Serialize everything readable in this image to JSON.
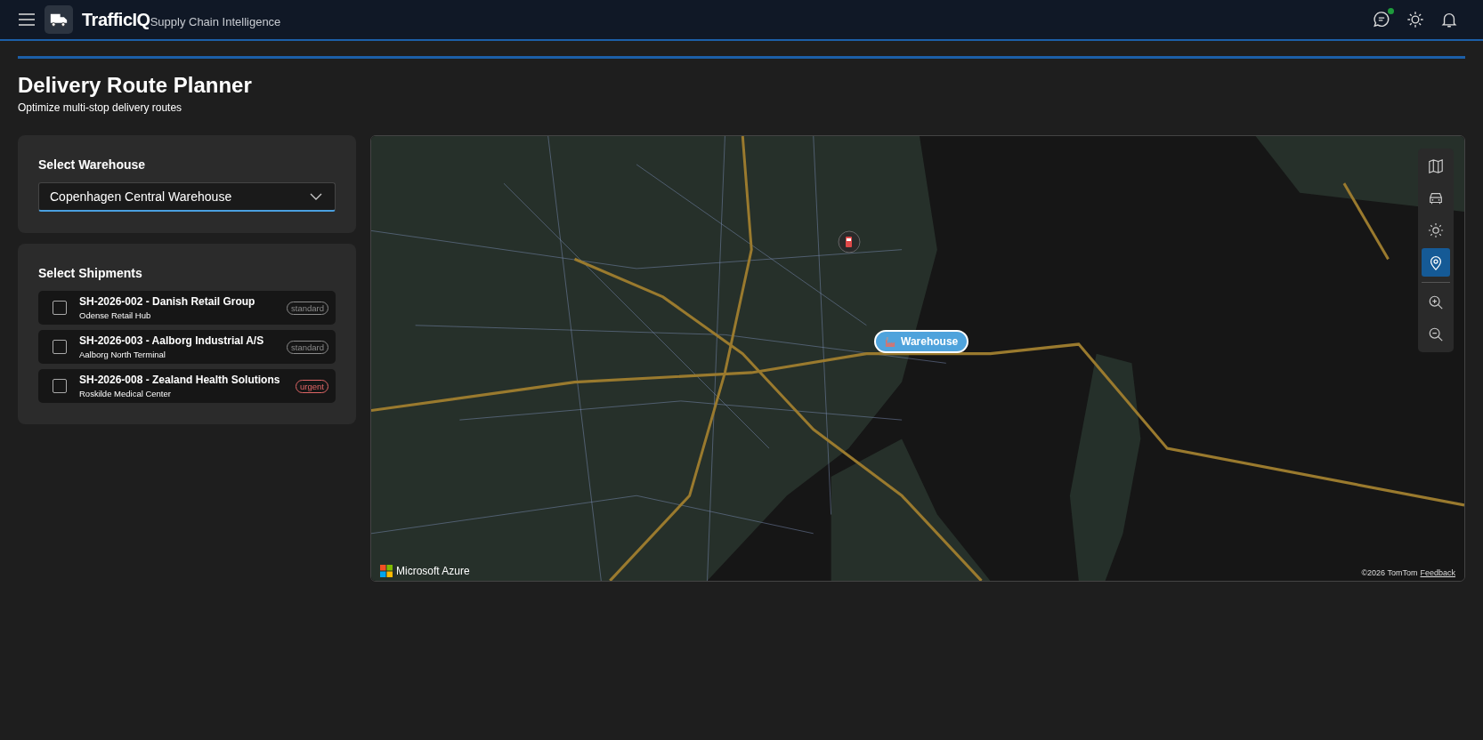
{
  "header": {
    "brand": "TrafficIQ",
    "tagline": "Supply Chain Intelligence",
    "chat_unread": true
  },
  "page": {
    "title": "Delivery Route Planner",
    "subtitle": "Optimize multi-stop delivery routes"
  },
  "warehouse_card": {
    "label": "Select Warehouse",
    "value": "Copenhagen Central Warehouse"
  },
  "shipments_card": {
    "label": "Select Shipments",
    "items": [
      {
        "title": "SH-2026-002 - Danish Retail Group",
        "destination": "Odense Retail Hub",
        "priority": "standard",
        "color": "#8a8a8a",
        "checked": false
      },
      {
        "title": "SH-2026-003 - Aalborg Industrial A/S",
        "destination": "Aalborg North Terminal",
        "priority": "standard",
        "color": "#8a8a8a",
        "checked": false
      },
      {
        "title": "SH-2026-008 - Zealand Health Solutions",
        "destination": "Roskilde Medical Center",
        "priority": "urgent",
        "color": "#e06666",
        "checked": false
      }
    ]
  },
  "map": {
    "marker": "Warehouse",
    "logo": "Microsoft Azure",
    "copyright": "©2026 TomTom",
    "feedback": "Feedback",
    "controls": [
      {
        "kind": "map",
        "selected": false
      },
      {
        "kind": "traffic",
        "selected": false
      },
      {
        "kind": "theme",
        "selected": false
      },
      {
        "kind": "pin",
        "selected": true
      }
    ],
    "zoom_controls": [
      {
        "kind": "zoom-in"
      },
      {
        "kind": "zoom-out"
      }
    ]
  }
}
